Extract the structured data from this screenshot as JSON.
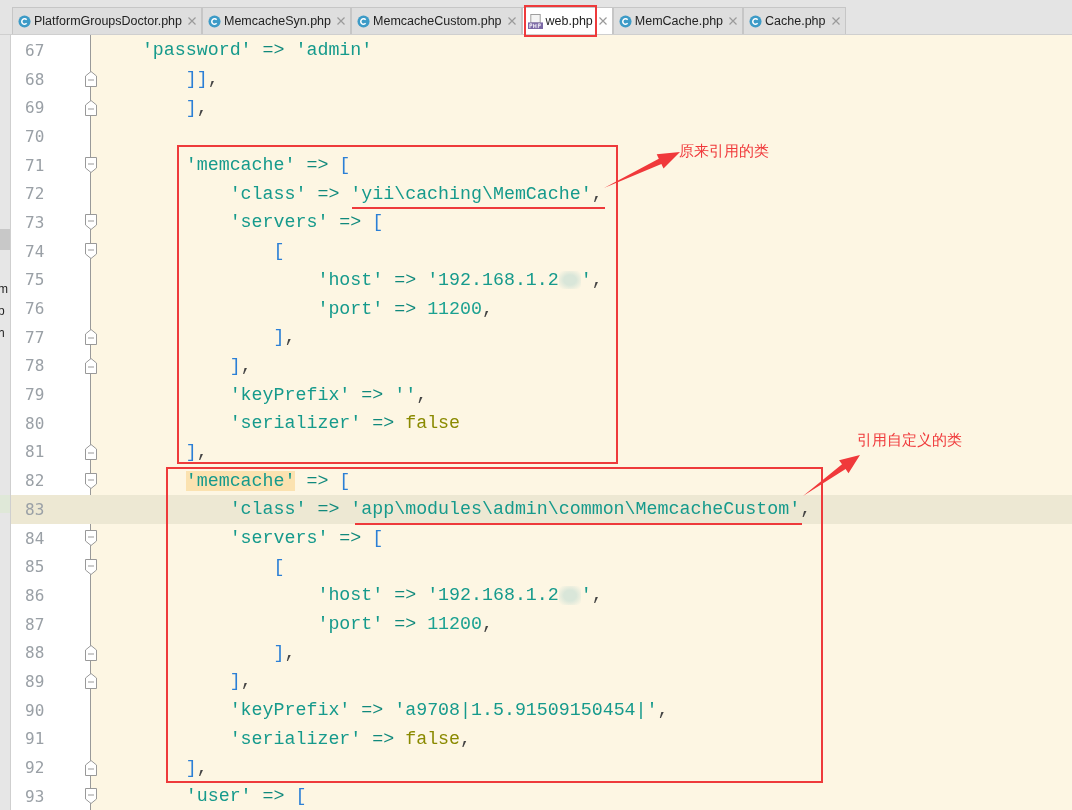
{
  "tabs": [
    {
      "label": "PlatformGroupsDoctor.php",
      "kind": "class",
      "selected": false
    },
    {
      "label": "MemcacheSyn.php",
      "kind": "class",
      "selected": false
    },
    {
      "label": "MemcacheCustom.php",
      "kind": "class",
      "selected": false
    },
    {
      "label": "web.php",
      "kind": "php",
      "selected": true
    },
    {
      "label": "MemCache.php",
      "kind": "class",
      "selected": false
    },
    {
      "label": "Cache.php",
      "kind": "class",
      "selected": false
    }
  ],
  "left_panel": {
    "items": [
      "m",
      "p",
      "h"
    ]
  },
  "editor": {
    "lines": [
      {
        "number": "67",
        "fold_open": false,
        "fold_close": false,
        "current": false,
        "tokens": [
          {
            "kind": "str",
            "s": "'password'"
          },
          {
            "kind": "op",
            "s": " => "
          },
          {
            "kind": "str",
            "s": "'admin'"
          }
        ],
        "children": [
          {
            "number": "68",
            "fold_open": false,
            "fold_close": true,
            "current": false,
            "tokens": [
              {
                "kind": "br",
                "s": "]]"
              },
              {
                "kind": "p",
                "s": ","
              }
            ]
          },
          {
            "number": "69",
            "fold_open": false,
            "fold_close": true,
            "current": false,
            "tokens": [
              {
                "kind": "br",
                "s": "]"
              },
              {
                "kind": "p",
                "s": ","
              }
            ]
          },
          {
            "number": "70",
            "fold_open": false,
            "fold_close": false,
            "current": false
          },
          {
            "number": "71",
            "fold_open": true,
            "fold_close": false,
            "current": false,
            "tokens": [
              {
                "kind": "str",
                "s": "'memcache'"
              },
              {
                "kind": "op",
                "s": " => "
              },
              {
                "kind": "br",
                "s": "["
              }
            ],
            "children": [
              {
                "number": "72",
                "fold_open": false,
                "fold_close": false,
                "current": false,
                "tokens": [
                  {
                    "kind": "str",
                    "s": "'class'"
                  },
                  {
                    "kind": "op",
                    "s": " => "
                  },
                  {
                    "kind": "str",
                    "s": "'yii\\caching\\MemCache'"
                  },
                  {
                    "kind": "p",
                    "s": ","
                  }
                ]
              },
              {
                "number": "73",
                "fold_open": true,
                "fold_close": false,
                "current": false,
                "tokens": [
                  {
                    "kind": "str",
                    "s": "'servers'"
                  },
                  {
                    "kind": "op",
                    "s": " => "
                  },
                  {
                    "kind": "br",
                    "s": "["
                  }
                ],
                "children": [
                  {
                    "number": "74",
                    "fold_open": true,
                    "fold_close": false,
                    "current": false,
                    "tokens": [
                      {
                        "kind": "br",
                        "s": "["
                      }
                    ],
                    "children": [
                      {
                        "number": "75",
                        "fold_open": false,
                        "fold_close": false,
                        "current": false,
                        "tokens": [
                          {
                            "kind": "str",
                            "s": "'host'"
                          },
                          {
                            "kind": "op",
                            "s": " => "
                          },
                          {
                            "kind": "str",
                            "s": "'192.168.1.2"
                          },
                          {
                            "kind": "redacted"
                          },
                          {
                            "kind": "str",
                            "s": "'"
                          },
                          {
                            "kind": "p",
                            "s": ","
                          }
                        ]
                      },
                      {
                        "number": "76",
                        "fold_open": false,
                        "fold_close": false,
                        "current": false,
                        "tokens": [
                          {
                            "kind": "str",
                            "s": "'port'"
                          },
                          {
                            "kind": "op",
                            "s": " => "
                          },
                          {
                            "kind": "num",
                            "s": "11200"
                          },
                          {
                            "kind": "p",
                            "s": ","
                          }
                        ]
                      }
                    ]
                  },
                  {
                    "number": "77",
                    "fold_open": false,
                    "fold_close": true,
                    "current": false,
                    "tokens": [
                      {
                        "kind": "br",
                        "s": "]"
                      },
                      {
                        "kind": "p",
                        "s": ","
                      }
                    ]
                  }
                ]
              },
              {
                "number": "78",
                "fold_open": false,
                "fold_close": true,
                "current": false,
                "tokens": [
                  {
                    "kind": "br",
                    "s": "]"
                  },
                  {
                    "kind": "p",
                    "s": ","
                  }
                ]
              },
              {
                "number": "79",
                "fold_open": false,
                "fold_close": false,
                "current": false,
                "tokens": [
                  {
                    "kind": "str",
                    "s": "'keyPrefix'"
                  },
                  {
                    "kind": "op",
                    "s": " => "
                  },
                  {
                    "kind": "str",
                    "s": "''"
                  },
                  {
                    "kind": "p",
                    "s": ","
                  }
                ]
              },
              {
                "number": "80",
                "fold_open": false,
                "fold_close": false,
                "current": false,
                "tokens": [
                  {
                    "kind": "str",
                    "s": "'serializer'"
                  },
                  {
                    "kind": "op",
                    "s": " => "
                  },
                  {
                    "kind": "bool",
                    "s": "false"
                  }
                ]
              }
            ]
          },
          {
            "number": "81",
            "fold_open": false,
            "fold_close": true,
            "current": false,
            "tokens": [
              {
                "kind": "br",
                "s": "]"
              },
              {
                "kind": "p",
                "s": ","
              }
            ]
          },
          {
            "number": "82",
            "fold_open": true,
            "fold_close": false,
            "current": false,
            "tokens": [
              {
                "kind": "match",
                "s": "'memcache'"
              },
              {
                "kind": "op",
                "s": " => "
              },
              {
                "kind": "br",
                "s": "["
              }
            ],
            "children": [
              {
                "number": "83",
                "fold_open": false,
                "fold_close": false,
                "current": true,
                "tokens": [
                  {
                    "kind": "str",
                    "s": "'class'"
                  },
                  {
                    "kind": "op",
                    "s": " => "
                  },
                  {
                    "kind": "str",
                    "s": "'app\\modules\\admin\\common\\MemcacheCustom'"
                  },
                  {
                    "kind": "p",
                    "s": ","
                  }
                ]
              },
              {
                "number": "84",
                "fold_open": true,
                "fold_close": false,
                "current": false,
                "tokens": [
                  {
                    "kind": "str",
                    "s": "'servers'"
                  },
                  {
                    "kind": "op",
                    "s": " => "
                  },
                  {
                    "kind": "br",
                    "s": "["
                  }
                ],
                "children": [
                  {
                    "number": "85",
                    "fold_open": true,
                    "fold_close": false,
                    "current": false,
                    "tokens": [
                      {
                        "kind": "br",
                        "s": "["
                      }
                    ],
                    "children": [
                      {
                        "number": "86",
                        "fold_open": false,
                        "fold_close": false,
                        "current": false,
                        "tokens": [
                          {
                            "kind": "str",
                            "s": "'host'"
                          },
                          {
                            "kind": "op",
                            "s": " => "
                          },
                          {
                            "kind": "str",
                            "s": "'192.168.1.2"
                          },
                          {
                            "kind": "redacted"
                          },
                          {
                            "kind": "str",
                            "s": "'"
                          },
                          {
                            "kind": "p",
                            "s": ","
                          }
                        ]
                      },
                      {
                        "number": "87",
                        "fold_open": false,
                        "fold_close": false,
                        "current": false,
                        "tokens": [
                          {
                            "kind": "str",
                            "s": "'port'"
                          },
                          {
                            "kind": "op",
                            "s": " => "
                          },
                          {
                            "kind": "num",
                            "s": "11200"
                          },
                          {
                            "kind": "p",
                            "s": ","
                          }
                        ]
                      }
                    ]
                  },
                  {
                    "number": "88",
                    "fold_open": false,
                    "fold_close": true,
                    "current": false,
                    "tokens": [
                      {
                        "kind": "br",
                        "s": "]"
                      },
                      {
                        "kind": "p",
                        "s": ","
                      }
                    ]
                  }
                ]
              },
              {
                "number": "89",
                "fold_open": false,
                "fold_close": true,
                "current": false,
                "tokens": [
                  {
                    "kind": "br",
                    "s": "]"
                  },
                  {
                    "kind": "p",
                    "s": ","
                  }
                ]
              },
              {
                "number": "90",
                "fold_open": false,
                "fold_close": false,
                "current": false,
                "tokens": [
                  {
                    "kind": "str",
                    "s": "'keyPrefix'"
                  },
                  {
                    "kind": "op",
                    "s": " => "
                  },
                  {
                    "kind": "str",
                    "s": "'a9708|1.5.91509150454|'"
                  },
                  {
                    "kind": "p",
                    "s": ","
                  }
                ]
              },
              {
                "number": "91",
                "fold_open": false,
                "fold_close": false,
                "current": false,
                "tokens": [
                  {
                    "kind": "str",
                    "s": "'serializer'"
                  },
                  {
                    "kind": "op",
                    "s": " => "
                  },
                  {
                    "kind": "bool",
                    "s": "false"
                  },
                  {
                    "kind": "p",
                    "s": ","
                  }
                ]
              }
            ]
          },
          {
            "number": "92",
            "fold_open": false,
            "fold_close": true,
            "current": false,
            "tokens": [
              {
                "kind": "br",
                "s": "]"
              },
              {
                "kind": "p",
                "s": ","
              }
            ]
          },
          {
            "number": "93",
            "fold_open": true,
            "fold_close": false,
            "current": false,
            "tokens": [
              {
                "kind": "str",
                "s": "'user'"
              },
              {
                "kind": "op",
                "s": " => "
              },
              {
                "kind": "br",
                "s": "["
              }
            ]
          }
        ]
      }
    ]
  },
  "annotations": [
    {
      "label": "原来引用的类"
    },
    {
      "label": "引用自定义的类"
    }
  ]
}
